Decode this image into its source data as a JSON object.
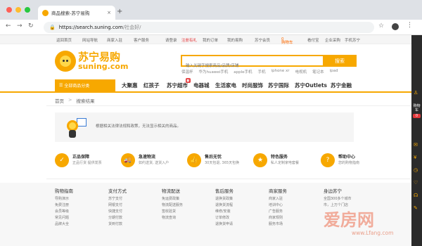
{
  "browser": {
    "tab_title": "商品搜索-苏宁易购",
    "tab_close": "×",
    "new_tab": "+",
    "url_host": "https://search.suning.com",
    "url_path": "/社会好/",
    "back": "←",
    "forward": "→",
    "reload": "↻",
    "star": "☆",
    "kebab": "⋮",
    "lock": "🔒"
  },
  "top_links": {
    "home": "返回首页",
    "site_nav": "网站导航",
    "merchant_join": "商家入驻",
    "customer_service": "客户服务",
    "login": "请登录",
    "register": "注册有礼",
    "my_orders": "我的订单",
    "my_yigou": "我的易购",
    "company": "苏宁会员",
    "cart": "购物车",
    "cart_count": "0",
    "kanfenqi": "看付宝",
    "enterprise": "企业采购",
    "phone_app": "手机苏宁"
  },
  "logo": {
    "cn": "苏宁易购",
    "en": "suning.com"
  },
  "search": {
    "placeholder": "输入关键字搜索商品/品牌/店铺",
    "button": "搜索",
    "hot_words": [
      "保温杯",
      "华为huawei手机",
      "apple手机",
      "手机",
      "iphone xr",
      "电视机",
      "笔记本",
      "ipad"
    ]
  },
  "catbar": {
    "all_categories": "全部商品分类",
    "nav": [
      "大聚惠",
      "红孩子",
      "苏宁超市",
      "电器城",
      "生活家电",
      "时尚服饰",
      "苏宁国际",
      "苏宁Outlets",
      "苏宁金融"
    ],
    "supermarket_badge": "新"
  },
  "breadcrumb": {
    "home": "首页",
    "sep": ">",
    "current": "搜索结果"
  },
  "empty_result": {
    "message": "根据相关法律法规和政策，无法显示相关的商品。"
  },
  "services": [
    {
      "icon": "✓",
      "title": "正品保障",
      "desc": "正品行货 提供发票"
    },
    {
      "icon": "🚚",
      "title": "急速物流",
      "desc": "如约送货, 送货入户"
    },
    {
      "icon": "👍",
      "title": "售后无忧",
      "desc": "30天包退, 365天包换"
    },
    {
      "icon": "★",
      "title": "特色服务",
      "desc": "私人定制家电套餐"
    },
    {
      "icon": "?",
      "title": "帮助中心",
      "desc": "您的购物指南"
    }
  ],
  "footer": [
    {
      "heading": "购物指南",
      "items": [
        "导购演示",
        "免费注册",
        "会员等级",
        "常见问题",
        "品牌大全"
      ]
    },
    {
      "heading": "支付方式",
      "items": [
        "苏宁支付",
        "网银支付",
        "快捷支付",
        "分期付款",
        "货到付款"
      ]
    },
    {
      "heading": "物流配送",
      "items": [
        "免运费政策",
        "物流配送服务",
        "签收验货",
        "物流查询"
      ]
    },
    {
      "heading": "售后服务",
      "items": [
        "退换货政策",
        "退换货流程",
        "维修/安装",
        "订单修改",
        "退换货申请"
      ]
    },
    {
      "heading": "商家服务",
      "items": [
        "商家入驻",
        "培训中心",
        "广告服务",
        "商家规则",
        "服务市场"
      ]
    },
    {
      "heading": "身边苏宁",
      "items": [
        "全国300多个城市",
        "市，上万个门店"
      ]
    }
  ],
  "sidebar": {
    "cart_label": "购物车",
    "cart_count": "0"
  },
  "watermark": {
    "brand": "爱房网",
    "url": "www.Lfang.com"
  },
  "colors": {
    "brand": "#f7a800",
    "red": "#e4393c",
    "sidebar": "#2b2b2b"
  }
}
